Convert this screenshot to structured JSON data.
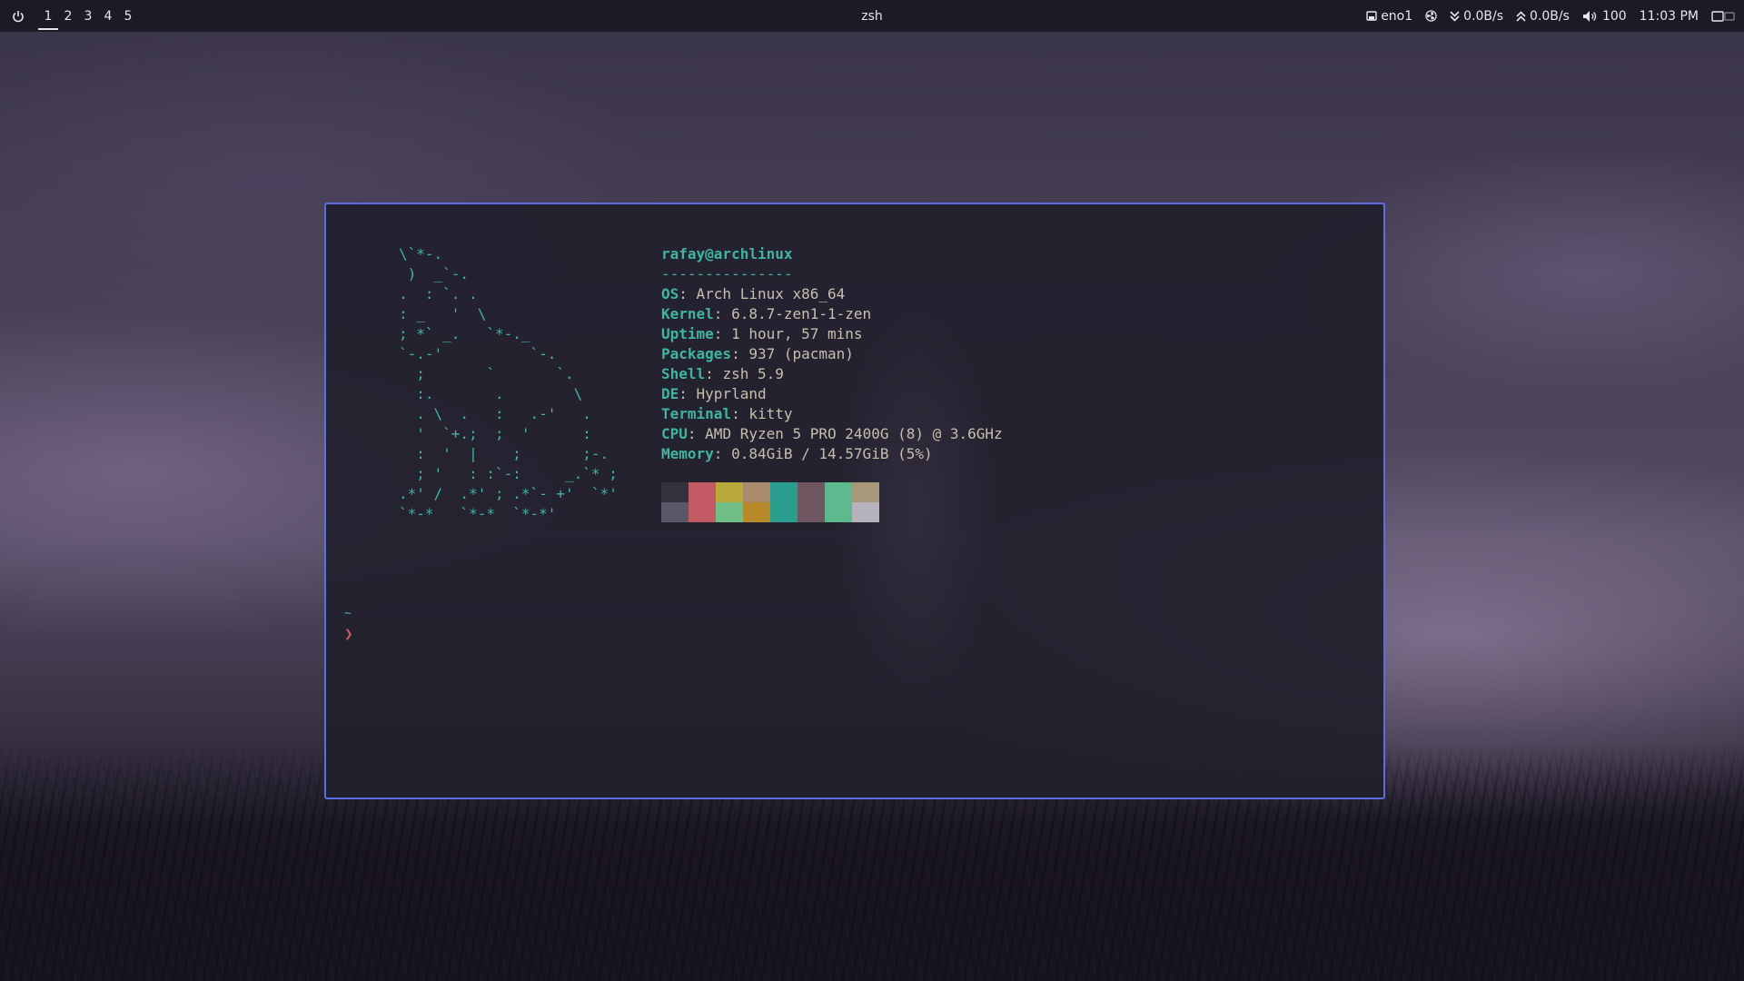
{
  "topbar": {
    "workspaces": [
      {
        "label": "1",
        "active": true
      },
      {
        "label": "2",
        "active": false
      },
      {
        "label": "3",
        "active": false
      },
      {
        "label": "4",
        "active": false
      },
      {
        "label": "5",
        "active": false
      }
    ],
    "window_title": "zsh",
    "network_interface": "eno1",
    "download_rate": "0.0B/s",
    "upload_rate": "0.0B/s",
    "volume": "100",
    "clock": "11:03 PM"
  },
  "terminal": {
    "user_host": "rafay@archlinux",
    "separator": "---------------",
    "ascii_art": "\\`*-.\n )  _`-.\n.  : `. .\n: _   '  \\\n; *` _.   `*-._\n`-.-'          `-.\n  ;       `       `.\n  :.       .        \\\n  . \\  .   :   .-'   .\n  '  `+.;  ;  '      :\n  :  '  |    ;       ;-.\n  ; '   : :`-:     _.`* ;\n.*' /  .*' ; .*`- +'  `*'\n`*-*   `*-*  `*-*'",
    "info": [
      {
        "key": "OS",
        "value": "Arch Linux x86_64"
      },
      {
        "key": "Kernel",
        "value": "6.8.7-zen1-1-zen"
      },
      {
        "key": "Uptime",
        "value": "1 hour, 57 mins"
      },
      {
        "key": "Packages",
        "value": "937 (pacman)"
      },
      {
        "key": "Shell",
        "value": "zsh 5.9"
      },
      {
        "key": "DE",
        "value": "Hyprland"
      },
      {
        "key": "Terminal",
        "value": "kitty"
      },
      {
        "key": "CPU",
        "value": "AMD Ryzen 5 PRO 2400G (8) @ 3.6GHz"
      },
      {
        "key": "Memory",
        "value": "0.84GiB / 14.57GiB (5%)"
      }
    ],
    "palette_top": [
      "#35323e",
      "#c45a64",
      "#b8a93a",
      "#a98b6c",
      "#2a9d8f",
      "#6e5560",
      "#5fb98f",
      "#a8987a"
    ],
    "palette_bottom": [
      "#5a5766",
      "#c45a64",
      "#6fbf87",
      "#b8892a",
      "#2a9d8f",
      "#6e5560",
      "#5fb98f",
      "#b6b2bc"
    ],
    "prompt_dir": "~",
    "prompt_symbol": "❯"
  },
  "colors": {
    "accent_border": "#5b6ee1",
    "teal": "#3fb59f",
    "text": "#c7bfae",
    "bar_bg": "#1c1a26"
  }
}
